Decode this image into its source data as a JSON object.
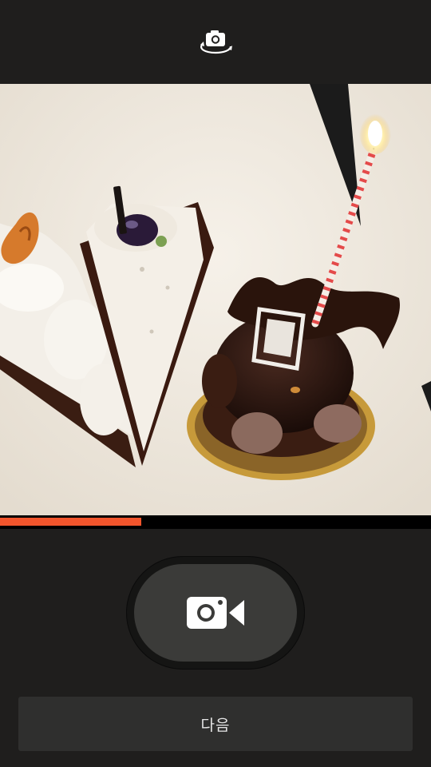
{
  "top_bar": {
    "icon": "camera-switch-icon"
  },
  "viewfinder": {
    "subject": "cake-slices-with-candle"
  },
  "recording": {
    "progress": 0.327,
    "accent_color": "#f2552c"
  },
  "record_button": {
    "icon": "photo-video-icon"
  },
  "next_button": {
    "label": "다음"
  }
}
